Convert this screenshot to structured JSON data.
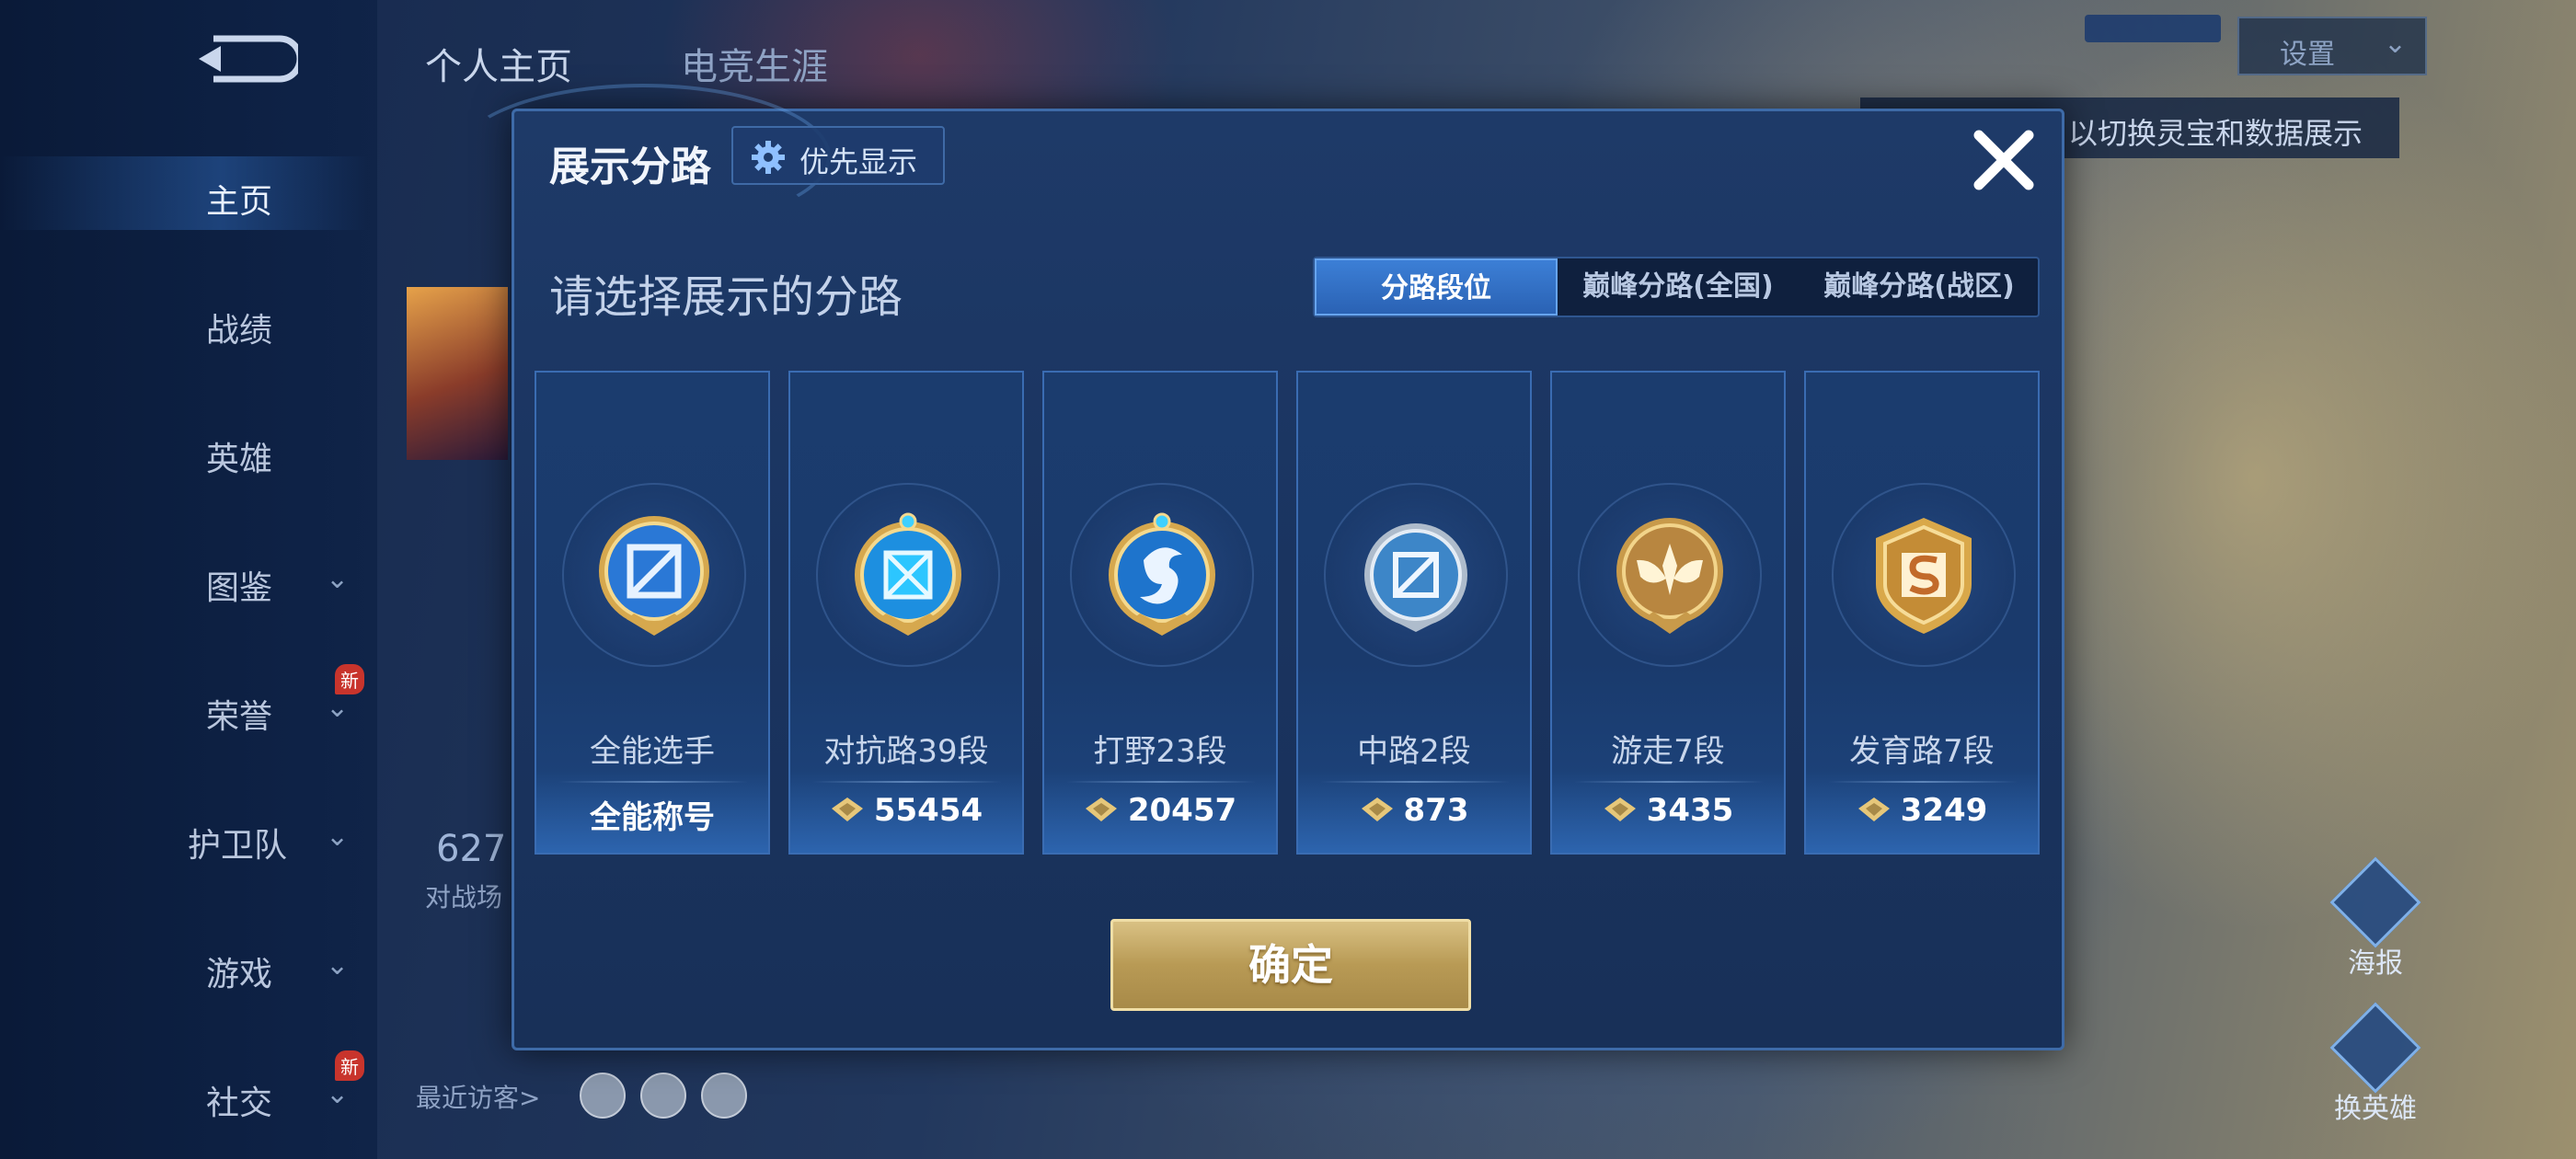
{
  "sidebar": {
    "items": [
      {
        "label": "主页",
        "active": true
      },
      {
        "label": "战绩"
      },
      {
        "label": "英雄"
      },
      {
        "label": "图鉴"
      },
      {
        "label": "荣誉",
        "badge": "新"
      },
      {
        "label": "护卫队"
      },
      {
        "label": "游戏"
      },
      {
        "label": "社交",
        "badge": "新"
      }
    ]
  },
  "header": {
    "tabs": [
      "个人主页",
      "电竞生涯"
    ],
    "settings_label": "设置",
    "hint": "以切换灵宝和数据展示"
  },
  "background": {
    "stat_value": "627",
    "stat_label": "对战场",
    "visitors_label": "最近访客>"
  },
  "right_actions": [
    {
      "label": "海报",
      "icon": "poster-icon"
    },
    {
      "label": "换英雄",
      "icon": "switch-hero-icon"
    }
  ],
  "modal": {
    "title": "展示分路",
    "priority_label": "优先显示",
    "subtitle": "请选择展示的分路",
    "tabs": [
      {
        "label": "分路段位",
        "active": true
      },
      {
        "label": "巅峰分路(全国)"
      },
      {
        "label": "巅峰分路(战区)"
      }
    ],
    "lanes": [
      {
        "name": "全能选手",
        "value": "全能称号",
        "icon": "all-round-emblem-icon"
      },
      {
        "name": "对抗路39段",
        "value": "55454",
        "icon": "clash-lane-emblem-icon"
      },
      {
        "name": "打野23段",
        "value": "20457",
        "icon": "jungle-emblem-icon"
      },
      {
        "name": "中路2段",
        "value": "873",
        "icon": "mid-lane-emblem-icon"
      },
      {
        "name": "游走7段",
        "value": "3435",
        "icon": "roam-emblem-icon"
      },
      {
        "name": "发育路7段",
        "value": "3249",
        "icon": "farm-lane-emblem-icon"
      }
    ],
    "confirm_label": "确定"
  },
  "colors": {
    "modal_bg": "#1a3460",
    "accent_blue": "#2a62b4",
    "gold": "#c9ad68"
  }
}
